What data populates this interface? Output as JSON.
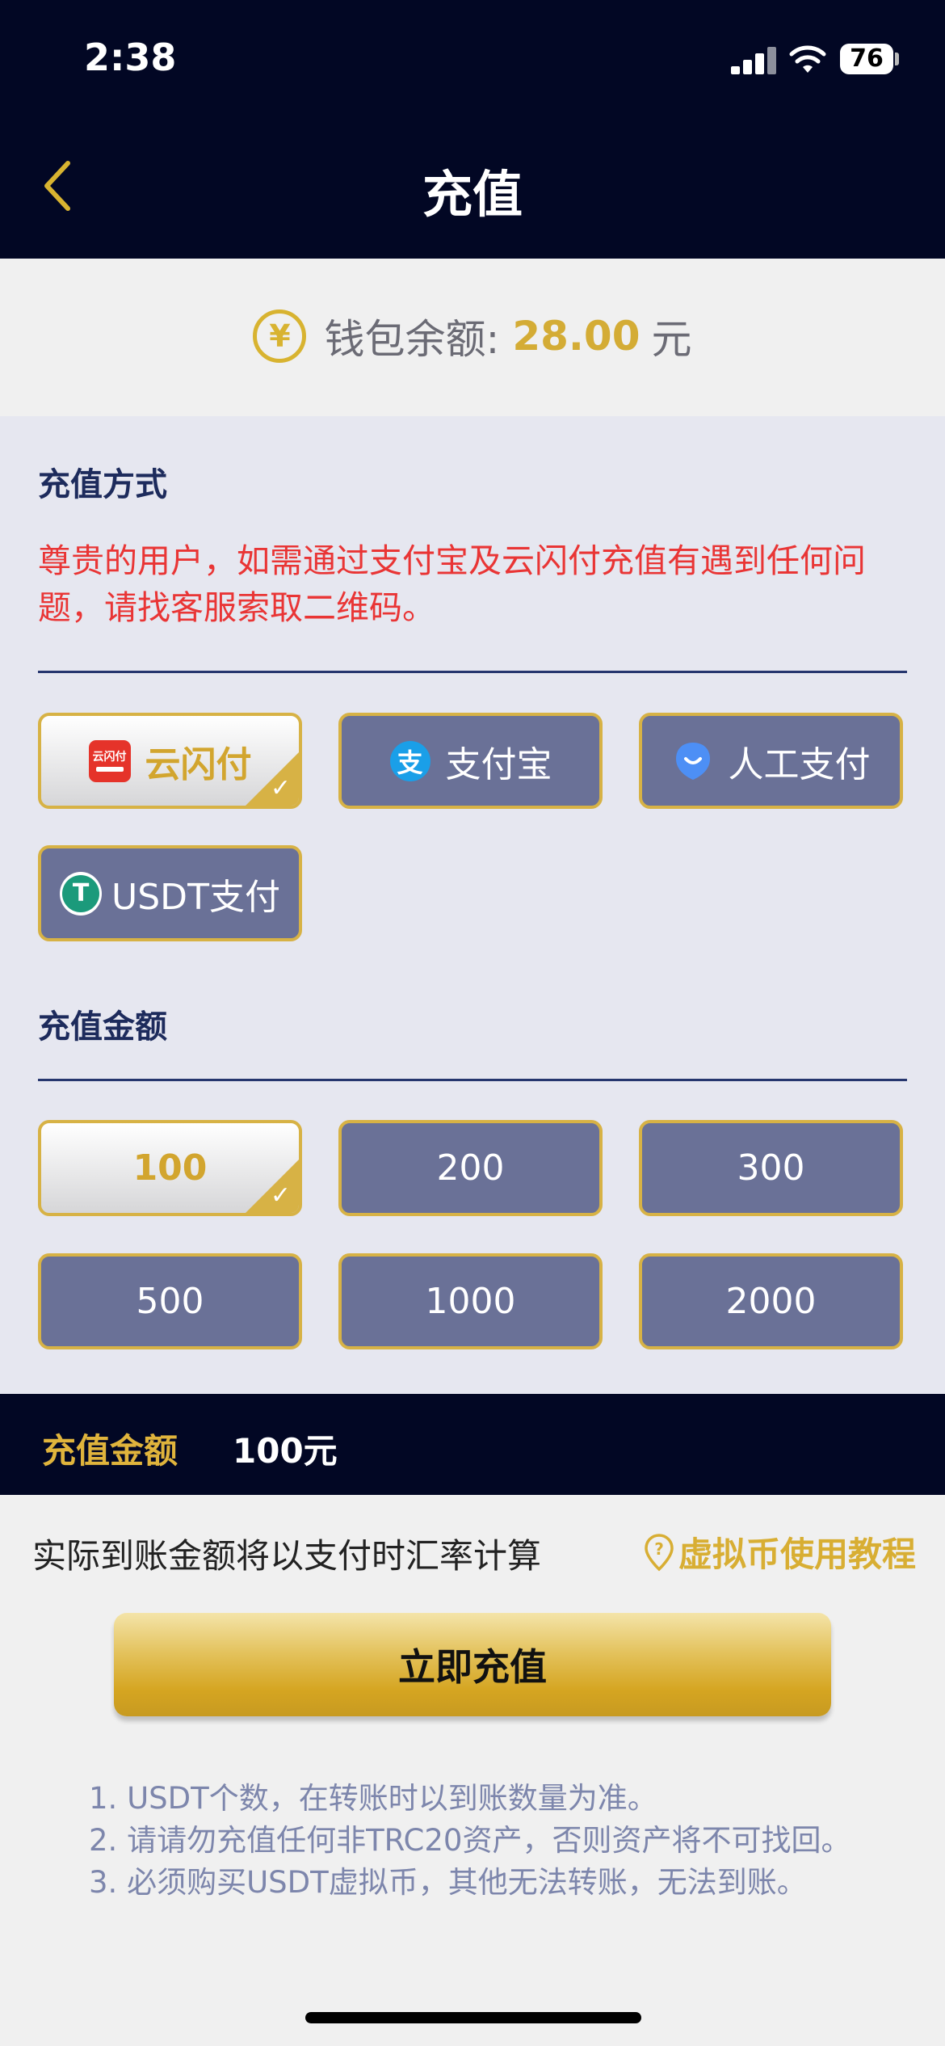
{
  "status_bar": {
    "time": "2:38",
    "battery": "76"
  },
  "header": {
    "title": "充值"
  },
  "balance": {
    "label": "钱包余额:",
    "value": "28.00",
    "unit": "元",
    "icon_symbol": "¥"
  },
  "payment_method": {
    "title": "充值方式",
    "notice": "尊贵的用户，如需通过支付宝及云闪付充值有遇到任何问题，请找客服索取二维码。",
    "options": [
      {
        "label": "云闪付",
        "icon": "unionpay-icon",
        "icon_text": "云闪付",
        "selected": true
      },
      {
        "label": "支付宝",
        "icon": "alipay-icon",
        "icon_text": "支",
        "selected": false
      },
      {
        "label": "人工支付",
        "icon": "manual-pay-icon",
        "selected": false
      },
      {
        "label": "USDT支付",
        "icon": "tether-icon",
        "icon_text": "T",
        "selected": false
      }
    ]
  },
  "amount": {
    "title": "充值金额",
    "options": [
      {
        "label": "100",
        "selected": true
      },
      {
        "label": "200",
        "selected": false
      },
      {
        "label": "300",
        "selected": false
      },
      {
        "label": "500",
        "selected": false
      },
      {
        "label": "1000",
        "selected": false
      },
      {
        "label": "2000",
        "selected": false
      }
    ]
  },
  "summary": {
    "label": "充值金额",
    "value": "100元"
  },
  "rate_note": "实际到账金额将以支付时汇率计算",
  "tutorial_link": "虚拟币使用教程",
  "submit_label": "立即充值",
  "notes": [
    "1. USDT个数，在转账时以到账数量为准。",
    "2. 请请勿充值任何非TRC20资产，否则资产将不可找回。",
    "3. 必须购买USDT虚拟币，其他无法转账，无法到账。"
  ],
  "colors": {
    "header_bg": "#020724",
    "accent_gold": "#d8b330",
    "option_bg": "#6a7197",
    "notice_red": "#e93535"
  }
}
